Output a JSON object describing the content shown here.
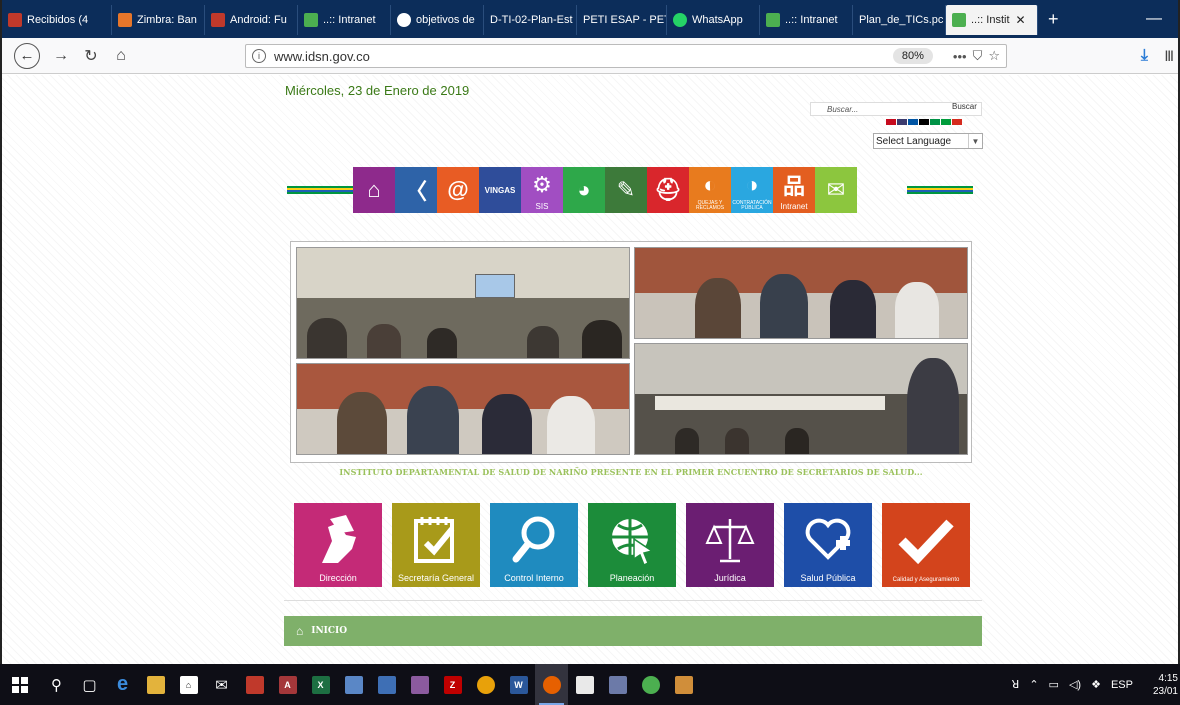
{
  "browser": {
    "tabs": [
      {
        "label": "Recibidos (4",
        "color": "#c0392b"
      },
      {
        "label": "Zimbra: Ban",
        "color": "#e6762a"
      },
      {
        "label": "Android: Fu",
        "color": "#c0392b"
      },
      {
        "label": "..:: Intranet",
        "color": "#4caf50"
      },
      {
        "label": "objetivos de",
        "color": "#ffffff"
      },
      {
        "label": "D-TI-02-Plan-Est",
        "color": ""
      },
      {
        "label": "PETI ESAP - PET",
        "color": ""
      },
      {
        "label": "WhatsApp",
        "color": "#25d366"
      },
      {
        "label": "..:: Intranet",
        "color": "#4caf50"
      },
      {
        "label": "Plan_de_TICs.pc",
        "color": ""
      }
    ],
    "active_tab": {
      "label": "..:: Instit",
      "color": "#4caf50"
    },
    "url": "www.idsn.gov.co",
    "zoom": "80%"
  },
  "page": {
    "date": "Miércoles, 23 de Enero de 2019",
    "search": {
      "placeholder": "Buscar...",
      "button": "Buscar"
    },
    "language_select": "Select Language",
    "flag_colors": [
      "#c60b1e",
      "#3c3b6e",
      "#0055a4",
      "#000000",
      "#009246",
      "#009c3b",
      "#d52b1e"
    ],
    "stripe_colors": [
      "#009640",
      "#fcd116",
      "#1e5fb4",
      "#009640"
    ],
    "toolbar_icons": [
      {
        "name": "home-icon",
        "color": "#8e2a8c",
        "glyph": "⌂",
        "label": ""
      },
      {
        "name": "feather-icon",
        "color": "#2e63a8",
        "glyph": "〈",
        "label": ""
      },
      {
        "name": "email-at-icon",
        "color": "#e85c24",
        "glyph": "@",
        "label": ""
      },
      {
        "name": "vingas-icon",
        "color": "#2f4d9a",
        "glyph": "",
        "label": "VINGAS"
      },
      {
        "name": "sis-icon",
        "color": "#a14ec2",
        "glyph": "⚙",
        "label": "SIS"
      },
      {
        "name": "owl-icon",
        "color": "#2ea84a",
        "glyph": "◕",
        "label": ""
      },
      {
        "name": "notepad-icon",
        "color": "#3d7a3a",
        "glyph": "✎",
        "label": ""
      },
      {
        "name": "helmet-icon",
        "color": "#d9262c",
        "glyph": "⛑",
        "label": ""
      },
      {
        "name": "quejas-icon",
        "color": "#e87b1e",
        "glyph": "◐",
        "label": "QUEJAS Y RECLAMOS"
      },
      {
        "name": "contratacion-icon",
        "color": "#2aa7e0",
        "glyph": "◑",
        "label": "CONTRATACIÓN PÚBLICA"
      },
      {
        "name": "intranet-icon",
        "color": "#e35e20",
        "glyph": "品",
        "label": "Intranet"
      },
      {
        "name": "mail-icon",
        "color": "#8cc63e",
        "glyph": "✉",
        "label": ""
      }
    ],
    "caption": "INSTITUTO DEPARTAMENTAL DE SALUD DE NARIÑO PRESENTE EN EL PRIMER ENCUENTRO DE SECRETARIOS DE SALUD...",
    "tiles": [
      {
        "label": "Dirección",
        "color": "#c42a77",
        "name": "tile-direccion"
      },
      {
        "label": "Secretaría General",
        "color": "#a89a1a",
        "name": "tile-secretaria-general"
      },
      {
        "label": "Control Interno",
        "color": "#1f8bbf",
        "name": "tile-control-interno"
      },
      {
        "label": "Planeación",
        "color": "#1c8c3a",
        "name": "tile-planeacion"
      },
      {
        "label": "Jurídica",
        "color": "#6b1e72",
        "name": "tile-juridica"
      },
      {
        "label": "Salud Pública",
        "color": "#1e4ea8",
        "name": "tile-salud-publica"
      },
      {
        "label": "Calidad y Aseguramiento",
        "color": "#d3441c",
        "name": "tile-calidad-aseguramiento"
      }
    ],
    "breadcrumb": "INICIO"
  },
  "taskbar": {
    "language": "ESP",
    "time": "4:15",
    "date": "23/01"
  }
}
